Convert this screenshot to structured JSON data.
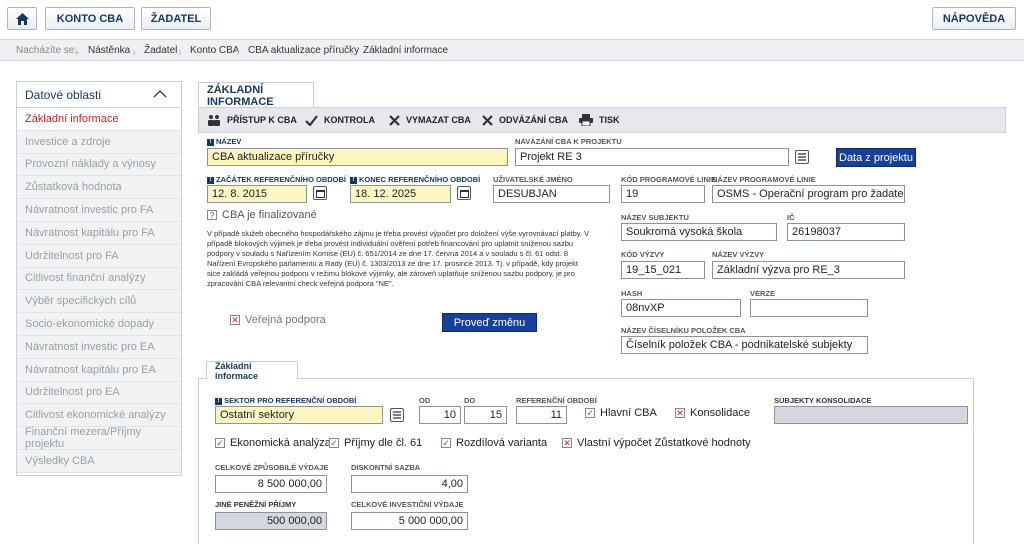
{
  "header": {
    "home_icon": "home-icon",
    "konto_cba": "KONTO CBA",
    "zadatel": "ŽADATEL",
    "napoveda": "NÁPOVĚDA"
  },
  "breadcrumb": {
    "prefix": "Nacházíte se:",
    "items": [
      "Nástěnka",
      "Žadatel",
      "Konto CBA",
      "CBA aktualizace příručky",
      "Základní informace"
    ]
  },
  "sidebar": {
    "title": "Datové oblasti",
    "items": [
      "Základní informace",
      "Investice a zdroje",
      "Provozní náklady a výnosy",
      "Zůstatková hodnota",
      "Návratnost investic pro FA",
      "Návratnost kapitálu pro FA",
      "Udržitelnost pro FA",
      "Citlivost finanční analýzy",
      "Výběr specifických cílů",
      "Socio-ekonomické dopady",
      "Návratnost investic pro EA",
      "Návratnost kapitálu pro EA",
      "Udržitelnost pro EA",
      "Citlivost ekonomické analýzy",
      "Finanční mezera/Příjmy projektu",
      "Výsledky CBA"
    ]
  },
  "main": {
    "tab": "ZÁKLADNÍ INFORMACE",
    "toolbar": {
      "pristup": "PŘÍSTUP K CBA",
      "kontrola": "KONTROLA",
      "vymazat": "VYMAZAT CBA",
      "odvazani": "ODVÁZÁNÍ CBA",
      "tisk": "TISK"
    },
    "form": {
      "nazev_label": "NÁZEV",
      "nazev_value": "CBA aktualizace příručky",
      "navazani_label": "NAVÁZÁNÍ CBA K PROJEKTU",
      "navazani_value": "Projekt RE 3",
      "data_z_projektu": "Data z projektu",
      "zacatek_label": "ZAČÁTEK REFERENČNÍHO OBDOBÍ",
      "zacatek_value": "12. 8. 2015",
      "konec_label": "KONEC REFERENČNÍHO OBDOBÍ",
      "konec_value": "18. 12. 2025",
      "uzivatel_label": "UŽIVATELSKÉ JMÉNO",
      "uzivatel_value": "DESUBJAN",
      "kod_pl_label": "KÓD PROGRAMOVÉ LINIE",
      "kod_pl_value": "19",
      "nazev_pl_label": "NÁZEV PROGRAMOVÉ LINIE",
      "nazev_pl_value": "OSMS - Operační program pro žadatele",
      "finalizovane": "CBA je finalizované",
      "nazev_subjektu_label": "NÁZEV SUBJEKTU",
      "nazev_subjektu_value": "Soukromá vysoká škola",
      "ic_label": "IČ",
      "ic_value": "26198037",
      "paragraph": "V případě služeb obecného hospodářského zájmu je třeba provést výpočet pro doložení výše vyrovnávací platby. V případě blokových výjimek je třeba provést individuální ověření potřeb financování pro uplatnit sníženou sazbu podpory v souladu s Nařízením Komise (EU) č. 651/2014 ze dne 17. června 2014 a v souladu s čl. 61 odst. 8 Nařízení Evropského parlamentu a Rady (EU) č. 1303/2013 ze dne 17. prosince 2013. Tj. v případě, kdy projekt sice zakládá veřejnou podporu v režimu blokové výjimky, ale zároveň uplatňuje sníženou sazbu podpory, je pro zpracování CBA relevantní check veřejná podpora \"NE\".",
      "kod_vyzvy_label": "KÓD VÝZVY",
      "kod_vyzvy_value": "19_15_021",
      "nazev_vyzvy_label": "NÁZEV VÝZVY",
      "nazev_vyzvy_value": "Základní výzva pro RE_3",
      "hash_label": "HASH",
      "hash_value": "08nvXP",
      "verze_label": "VERZE",
      "verze_value": "",
      "verejna_podpora": "Veřejná podpora",
      "proved_zmenu": "Proveď změnu",
      "ciselnik_label": "NÁZEV ČÍSELNÍKU POLOŽEK CBA",
      "ciselnik_value": "Číselník položek CBA - podnikatelské subjekty"
    },
    "subtab": "Základní informace",
    "sub": {
      "sektor_label": "SEKTOR PRO REFERENČNÍ OBDOBÍ",
      "sektor_value": "Ostatní sektory",
      "od_label": "OD",
      "od_value": "10",
      "do_label": "DO",
      "do_value": "15",
      "ref_label": "REFERENČNÍ OBDOBÍ",
      "ref_value": "11",
      "hlavni_cba": "Hlavní CBA",
      "konsolidace": "Konsolidace",
      "subjekty_label": "SUBJEKTY KONSOLIDACE",
      "subjekty_value": "",
      "ekonomicka": "Ekonomická analýza",
      "prijmy": "Příjmy dle čl. 61",
      "rozdilova": "Rozdílová varianta",
      "vlastni": "Vlastní výpočet Zůstatkové hodnoty",
      "celkove_zpusobile_label": "CELKOVÉ ZPŮSOBILÉ VÝDAJE",
      "celkove_zpusobile_value": "8 500 000,00",
      "diskontni_label": "DISKONTNÍ SAZBA",
      "diskontni_value": "4,00",
      "jine_label": "JINÉ PENĚŽNÍ PŘÍJMY",
      "jine_value": "500 000,00",
      "celkove_invest_label": "CELKOVÉ INVESTIČNÍ VÝDAJE",
      "celkove_invest_value": "5 000 000,00"
    }
  },
  "colors": {
    "brand": "#17375e",
    "active_red": "#c0272d",
    "button_blue": "#17409a",
    "required_yellow": "#fbf6c2"
  }
}
